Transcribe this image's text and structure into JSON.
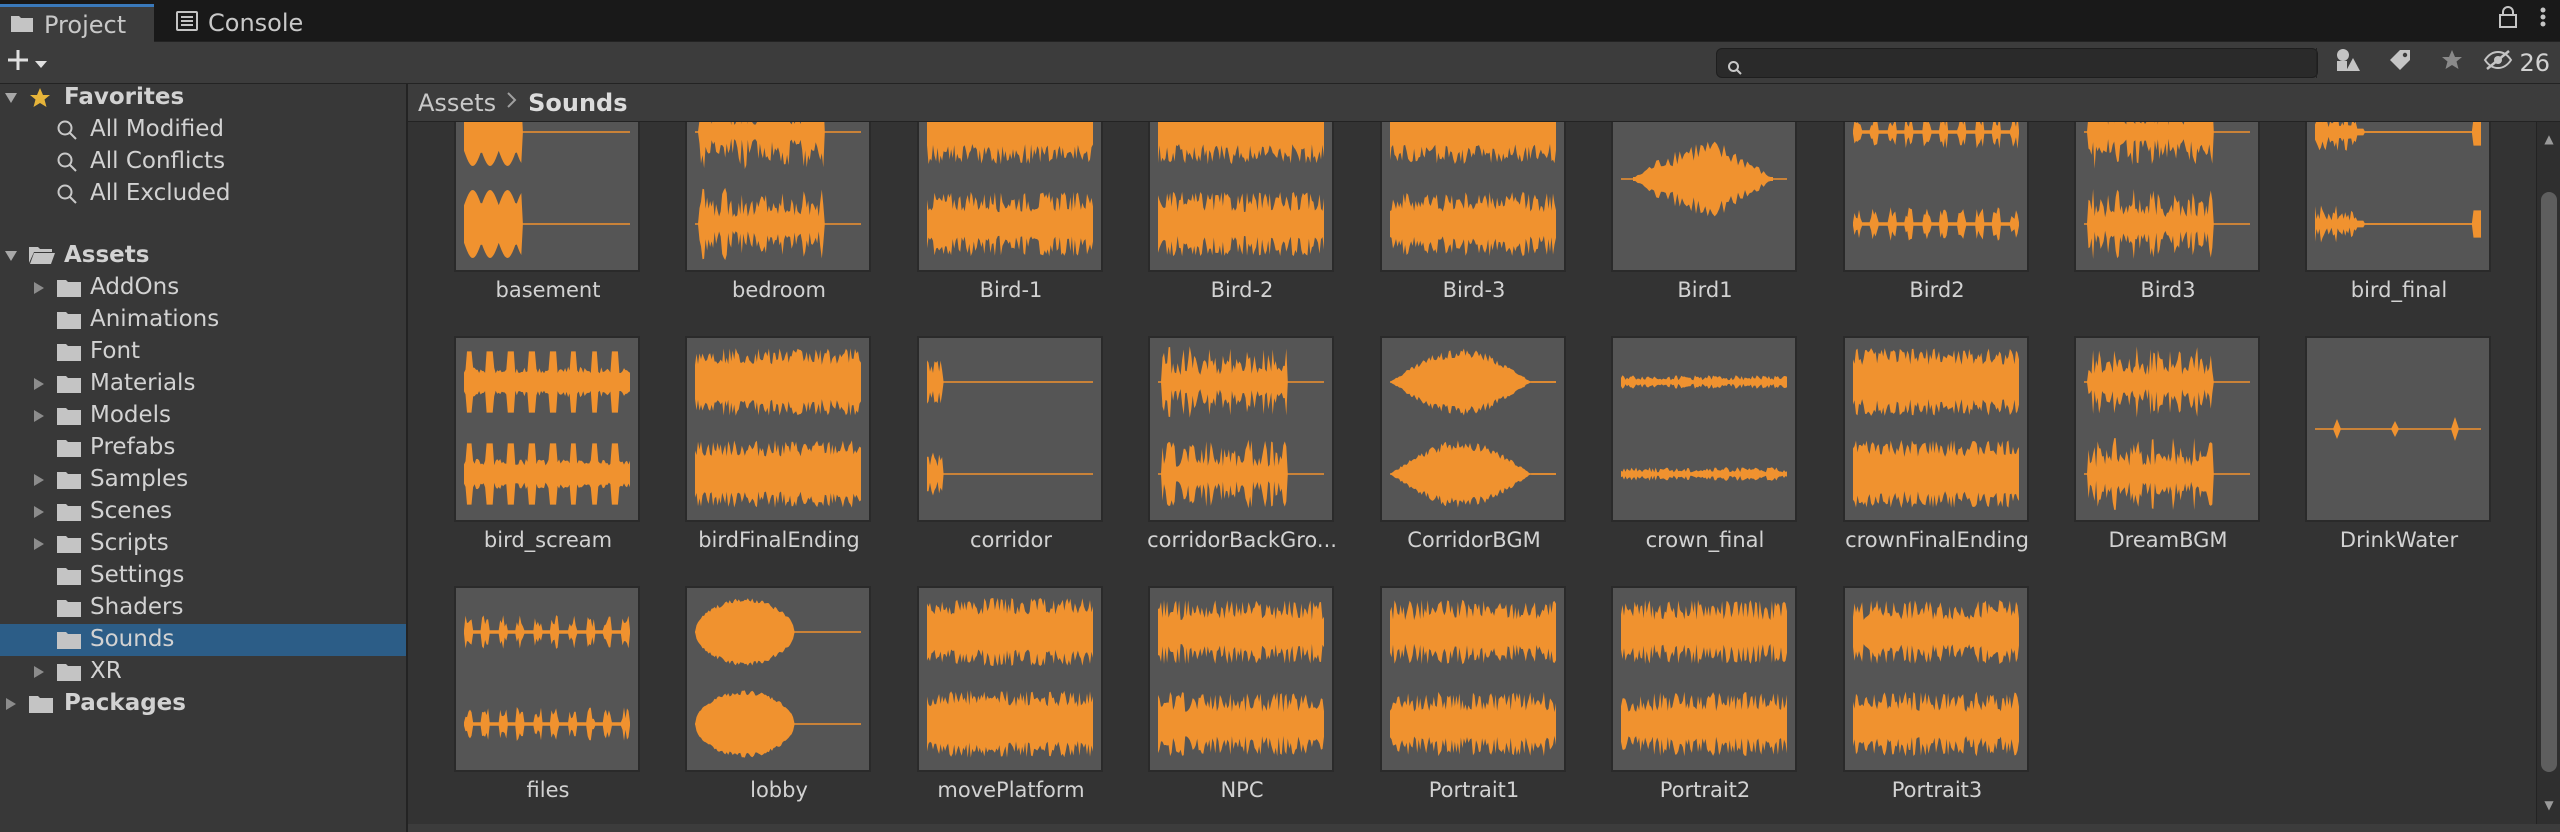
{
  "tabs": [
    {
      "label": "Project",
      "icon": "folder-icon",
      "active": true
    },
    {
      "label": "Console",
      "icon": "console-icon",
      "active": false
    }
  ],
  "toolbar": {
    "hidden_count": "26",
    "search": {
      "placeholder": "",
      "value": ""
    }
  },
  "sidebar": {
    "favorites": {
      "label": "Favorites",
      "items": [
        {
          "label": "All Modified"
        },
        {
          "label": "All Conflicts"
        },
        {
          "label": "All Excluded"
        }
      ]
    },
    "assets": {
      "label": "Assets",
      "items": [
        {
          "label": "AddOns",
          "expandable": true
        },
        {
          "label": "Animations",
          "expandable": false
        },
        {
          "label": "Font",
          "expandable": false
        },
        {
          "label": "Materials",
          "expandable": true
        },
        {
          "label": "Models",
          "expandable": true
        },
        {
          "label": "Prefabs",
          "expandable": false
        },
        {
          "label": "Samples",
          "expandable": true
        },
        {
          "label": "Scenes",
          "expandable": true
        },
        {
          "label": "Scripts",
          "expandable": true
        },
        {
          "label": "Settings",
          "expandable": false
        },
        {
          "label": "Shaders",
          "expandable": false
        },
        {
          "label": "Sounds",
          "expandable": false,
          "selected": true
        },
        {
          "label": "XR",
          "expandable": true
        }
      ]
    },
    "packages": {
      "label": "Packages"
    }
  },
  "breadcrumb": {
    "root": "Assets",
    "current": "Sounds"
  },
  "colors": {
    "waveform": "#f0922f",
    "selection": "#2c5d87",
    "tab_accent": "#3a79bb"
  },
  "assets_grid": [
    {
      "name": "basement",
      "wave": "dual-bursts-left"
    },
    {
      "name": "bedroom",
      "wave": "dual-medium"
    },
    {
      "name": "Bird-1",
      "wave": "dual-dense"
    },
    {
      "name": "Bird-2",
      "wave": "dual-dense"
    },
    {
      "name": "Bird-3",
      "wave": "dual-dense"
    },
    {
      "name": "Bird1",
      "wave": "mono-center"
    },
    {
      "name": "Bird2",
      "wave": "dual-sparse"
    },
    {
      "name": "Bird3",
      "wave": "dual-medium"
    },
    {
      "name": "bird_final",
      "wave": "dual-edge"
    },
    {
      "name": "bird_scream",
      "wave": "dual-spikes"
    },
    {
      "name": "birdFinalEnding",
      "wave": "dual-full"
    },
    {
      "name": "corridor",
      "wave": "dual-left-tiny"
    },
    {
      "name": "corridorBackGro...",
      "wave": "dual-medium"
    },
    {
      "name": "CorridorBGM",
      "wave": "dual-blob"
    },
    {
      "name": "crown_final",
      "wave": "dual-thin"
    },
    {
      "name": "crownFinalEnding",
      "wave": "dual-full"
    },
    {
      "name": "DreamBGM",
      "wave": "dual-medium"
    },
    {
      "name": "DrinkWater",
      "wave": "mono-blips"
    },
    {
      "name": "files",
      "wave": "dual-sparse"
    },
    {
      "name": "lobby",
      "wave": "dual-blob-left"
    },
    {
      "name": "movePlatform",
      "wave": "dual-full"
    },
    {
      "name": "NPC",
      "wave": "dual-dense"
    },
    {
      "name": "Portrait1",
      "wave": "dual-dense"
    },
    {
      "name": "Portrait2",
      "wave": "dual-dense"
    },
    {
      "name": "Portrait3",
      "wave": "dual-dense"
    }
  ]
}
